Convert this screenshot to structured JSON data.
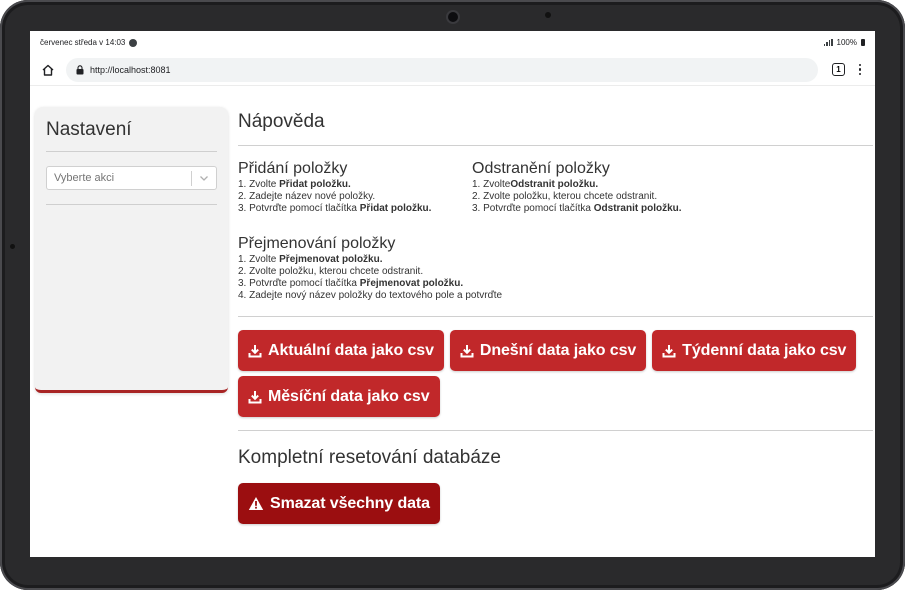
{
  "status_bar": {
    "datetime": "červenec středa v 14:03",
    "battery": "100%"
  },
  "browser": {
    "url": "http://localhost:8081",
    "tab_count": "1"
  },
  "sidebar": {
    "title": "Nastavení",
    "select_placeholder": "Vyberte akci"
  },
  "help": {
    "title": "Nápověda",
    "add": {
      "title": "Přidání položky",
      "s1_pre": "1. Zvolte ",
      "s1_b": "Přidat položku.",
      "s2": "2. Zadejte název nové položky.",
      "s3_pre": "3. Potvrďte pomocí tlačítka ",
      "s3_b": "Přidat položku."
    },
    "remove": {
      "title": "Odstranění položky",
      "s1_pre": "1. Zvolte",
      "s1_b": "Odstranit položku.",
      "s2": "2. Zvolte položku, kterou chcete odstranit.",
      "s3_pre": "3. Potvrďte pomocí tlačítka ",
      "s3_b": "Odstranit položku."
    },
    "rename": {
      "title": "Přejmenování položky",
      "s1_pre": "1. Zvolte ",
      "s1_b": "Přejmenovat položku.",
      "s2": "2. Zvolte položku, kterou chcete odstranit.",
      "s3_pre": "3. Potvrďte pomocí tlačítka ",
      "s3_b": "Přejmenovat položku.",
      "s4": "4. Zadejte nový název položky do textového pole a potvrďte"
    }
  },
  "export_buttons": {
    "current": "Aktuální data jako csv",
    "today": "Dnešní data jako csv",
    "weekly": "Týdenní data jako csv",
    "monthly": "Měsíční data jako csv"
  },
  "reset": {
    "title": "Kompletní resetování databáze",
    "button": "Smazat všechny data"
  },
  "colors": {
    "primary": "#c1282a",
    "danger": "#9b0e10",
    "sidebar_bg": "#f2f2f2"
  }
}
